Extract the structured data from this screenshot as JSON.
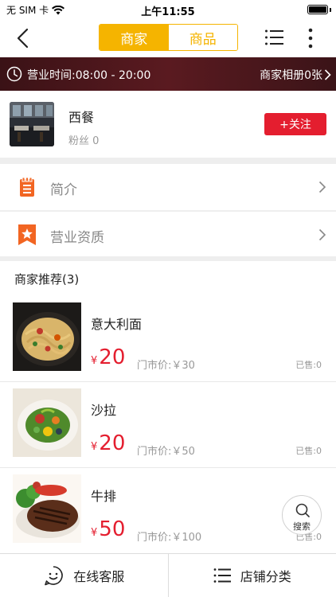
{
  "status_bar": {
    "carrier": "无 SIM 卡",
    "time": "上午11:55",
    "battery_level": 1.0
  },
  "nav": {
    "tabs": [
      {
        "label": "商家",
        "active": true
      },
      {
        "label": "商品",
        "active": false
      }
    ],
    "accent_color": "#f5b400"
  },
  "hours_banner": {
    "hours_text": "营业时间:08:00 - 20:00",
    "album_text": "商家相册0张"
  },
  "store": {
    "name": "西餐",
    "fans_text": "粉丝 0",
    "follow_label": "+关注",
    "follow_color": "#e41e2f"
  },
  "menu": {
    "intro_label": "简介",
    "license_label": "营业资质",
    "icon_color": "#f26522"
  },
  "recommend": {
    "title": "商家推荐(3)",
    "products": [
      {
        "name": "意大利面",
        "currency": "¥",
        "price": "20",
        "market_price": "门市价:￥30",
        "sold": "已售:0"
      },
      {
        "name": "沙拉",
        "currency": "¥",
        "price": "20",
        "market_price": "门市价:￥50",
        "sold": "已售:0"
      },
      {
        "name": "牛排",
        "currency": "¥",
        "price": "50",
        "market_price": "门市价:￥100",
        "sold": "已售:0"
      }
    ]
  },
  "search_fab": {
    "label": "搜索"
  },
  "bottom_bar": {
    "service_label": "在线客服",
    "category_label": "店铺分类"
  }
}
